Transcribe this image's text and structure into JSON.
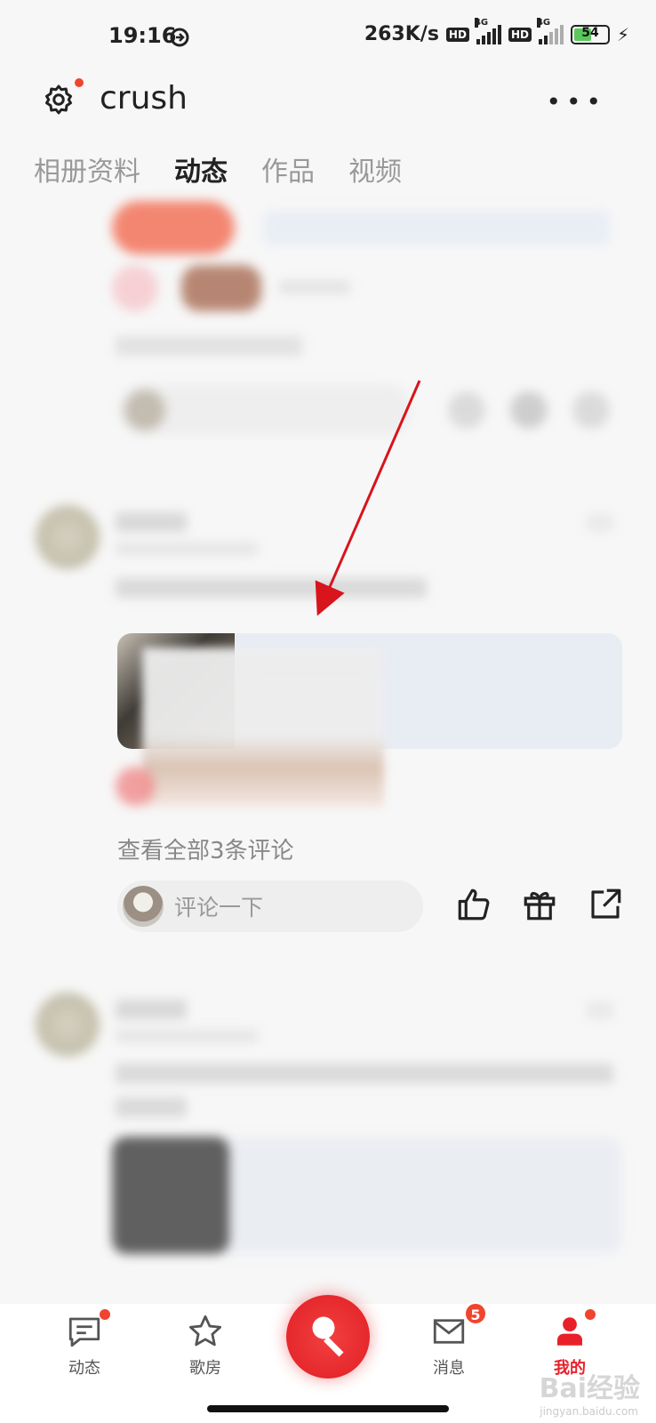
{
  "status_bar": {
    "time": "19:16",
    "network_speed": "263K/s",
    "hd1": "HD",
    "network1": "4G",
    "hd2": "HD",
    "network2": "4G",
    "battery": "54",
    "battery_level": 0.54
  },
  "header": {
    "title": "crush",
    "more_label": "•••"
  },
  "tabs": [
    {
      "label": "相册资料"
    },
    {
      "label": "动态",
      "active": true
    },
    {
      "label": "作品"
    },
    {
      "label": "视频"
    }
  ],
  "post": {
    "view_comments": "查看全部3条评论",
    "comment_placeholder": "评论一下"
  },
  "bottom_nav": {
    "items": [
      {
        "label": "动态"
      },
      {
        "label": "歌房"
      },
      {
        "label": "消息",
        "badge": "5"
      },
      {
        "label": "我的"
      }
    ]
  },
  "watermark": {
    "text": "Bai经验",
    "sub": "jingyan.baidu.com"
  },
  "colors": {
    "accent": "#e8202a",
    "notification_dot": "#f0442e",
    "arrow": "#d8141c"
  }
}
